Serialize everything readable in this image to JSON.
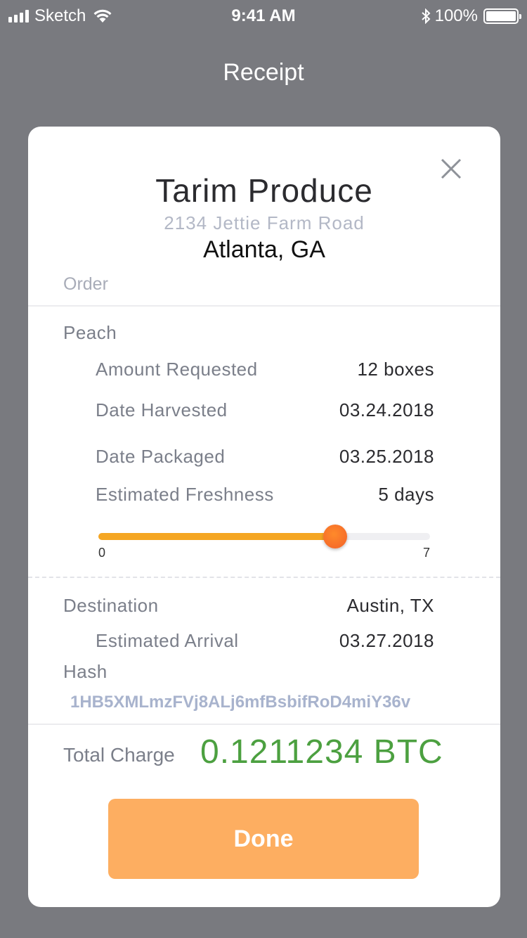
{
  "status_bar": {
    "carrier": "Sketch",
    "time": "9:41 AM",
    "battery_text": "100%",
    "battery_level": 1.0,
    "icons": [
      "signal-icon",
      "wifi-icon",
      "bluetooth-icon",
      "battery-icon"
    ]
  },
  "nav": {
    "title": "Receipt"
  },
  "receipt": {
    "close_icon": "close-icon",
    "vendor_name": "Tarim Produce",
    "vendor_street": "2134 Jettie Farm Road",
    "vendor_city": "Atlanta, GA",
    "order_label": "Order",
    "product": "Peach",
    "amount_label": "Amount Requested",
    "amount_value": "12 boxes",
    "harvested_label": "Date Harvested",
    "harvested_value": "03.24.2018",
    "packaged_label": "Date Packaged",
    "packaged_value": "03.25.2018",
    "freshness_label": "Estimated Freshness",
    "freshness_value": "5 days",
    "freshness_slider": {
      "min": "0",
      "max": "7",
      "value": 5,
      "min_num": 0,
      "max_num": 7
    },
    "destination_label": "Destination",
    "destination_value": "Austin, TX",
    "arrival_label": "Estimated Arrival",
    "arrival_value": "03.27.2018",
    "hash_label": "Hash",
    "hash_value": "1HB5XMLmzFVj8ALj6mfBsbifRoD4miY36v",
    "total_label": "Total Charge",
    "total_value": "0.1211234 BTC",
    "done_label": "Done"
  },
  "colors": {
    "background": "#797a7f",
    "accent_orange": "#fdae61",
    "slider_fill": "#f5a623",
    "total_green": "#4ca040"
  }
}
